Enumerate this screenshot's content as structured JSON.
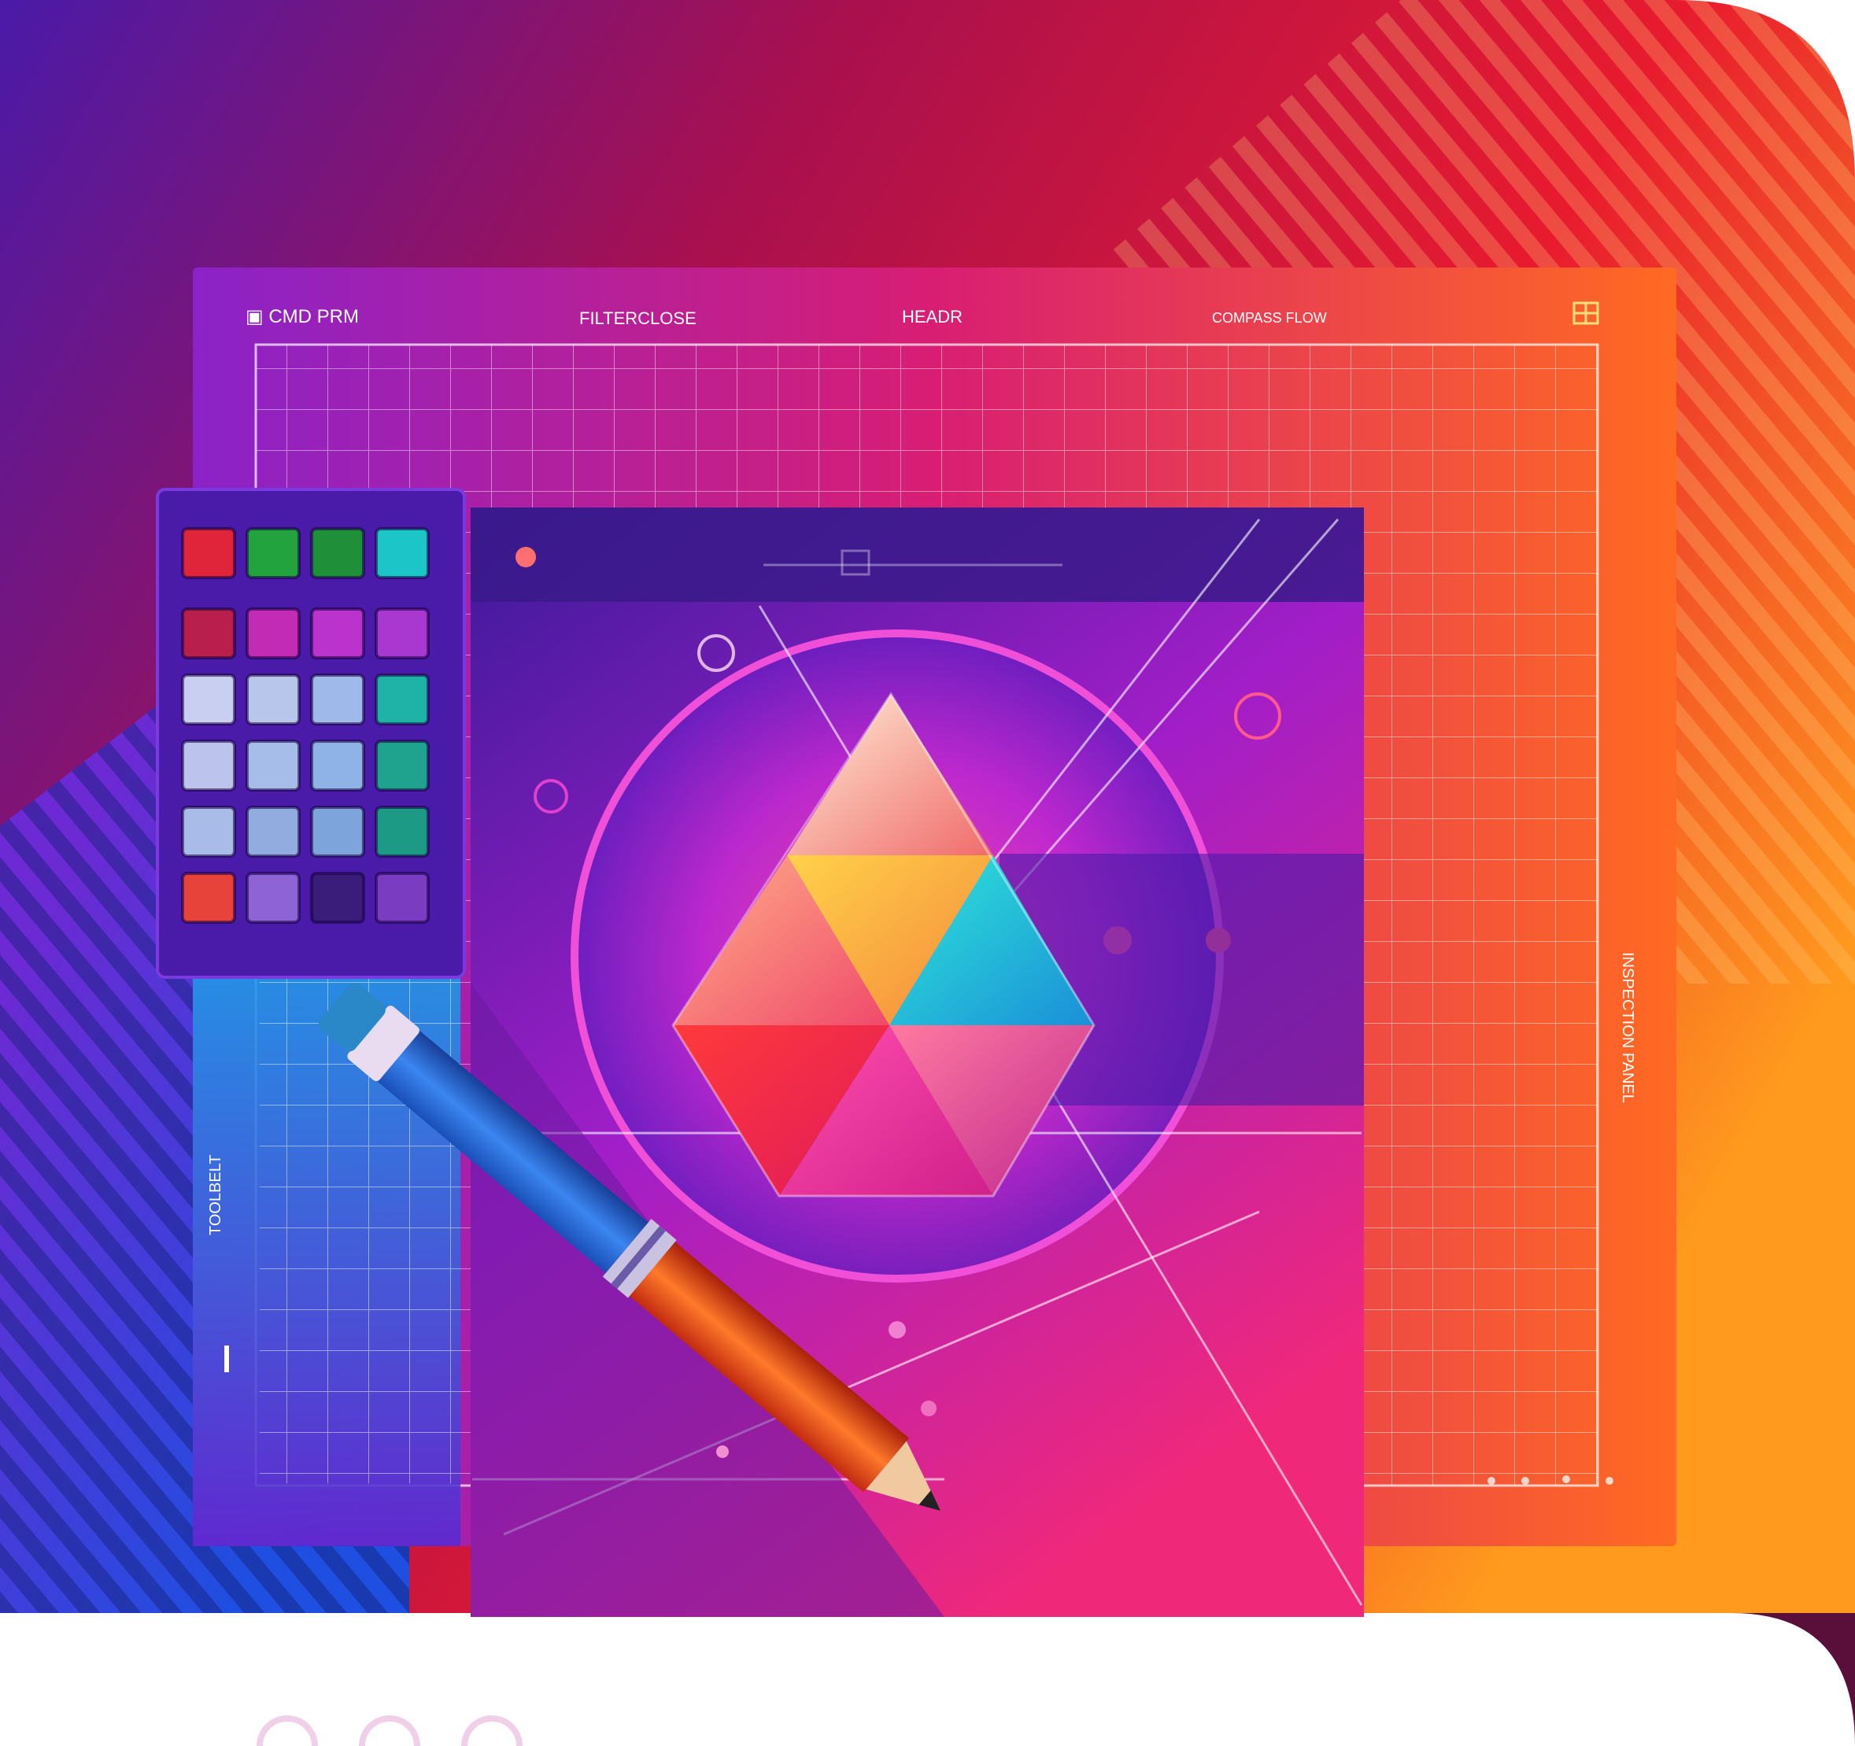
{
  "canvas": {
    "title_left": "▣ CMD PRM",
    "title_center_left": "FILTERCLOSE",
    "title_center": "HEADR",
    "title_right": "COMPASS FLOW",
    "side_label_right": "INSPECTION PANEL",
    "side_label_left": "TOOLBELT"
  },
  "palette": {
    "swatches": [
      "#e0243a",
      "#23a33e",
      "#1f8f3a",
      "#1cc6c8",
      "#b81f4c",
      "#c22bb3",
      "#b933cc",
      "#a838cf",
      "#c9cff0",
      "#b9c6ec",
      "#9eb9ea",
      "#1fb3a8",
      "#bcc4ee",
      "#a7bde9",
      "#8fb3e6",
      "#1fa38f",
      "#a9bbe8",
      "#93acdf",
      "#7ea4dc",
      "#1d9a86",
      "#e8433a",
      "#8d63d6",
      "#3a1d7a",
      "#7a3cc0"
    ]
  },
  "colors": {
    "bg_purple": "#5a1fb8",
    "bg_red": "#e0183a",
    "bg_orange": "#ff8a1c",
    "bg_blue": "#1f5fe6",
    "accent_magenta": "#e62fb8",
    "pencil_blue": "#2f6fe0",
    "pencil_orange": "#f0501a"
  },
  "icons": {
    "grid_icon": "grid-icon",
    "record_icon": "record-dot-icon",
    "pencil": "pencil-icon"
  }
}
